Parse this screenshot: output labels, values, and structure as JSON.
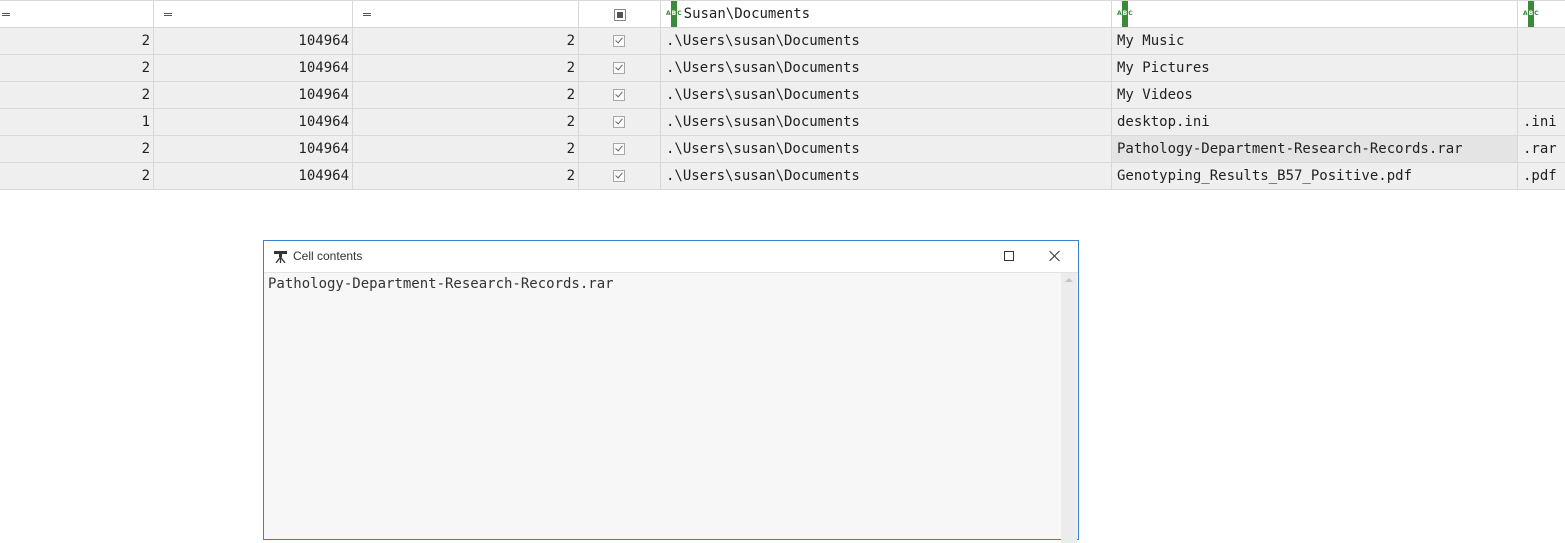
{
  "grid": {
    "header": {
      "path_column": "Susan\\Documents"
    },
    "rows": [
      {
        "c1": "2",
        "c2": "104964",
        "c3": "2",
        "checked": true,
        "path": ".\\Users\\susan\\Documents",
        "name": "My Music",
        "ext": ""
      },
      {
        "c1": "2",
        "c2": "104964",
        "c3": "2",
        "checked": true,
        "path": ".\\Users\\susan\\Documents",
        "name": "My Pictures",
        "ext": ""
      },
      {
        "c1": "2",
        "c2": "104964",
        "c3": "2",
        "checked": true,
        "path": ".\\Users\\susan\\Documents",
        "name": "My Videos",
        "ext": ""
      },
      {
        "c1": "1",
        "c2": "104964",
        "c3": "2",
        "checked": true,
        "path": ".\\Users\\susan\\Documents",
        "name": "desktop.ini",
        "ext": ".ini"
      },
      {
        "c1": "2",
        "c2": "104964",
        "c3": "2",
        "checked": true,
        "path": ".\\Users\\susan\\Documents",
        "name": "Pathology-Department-Research-Records.rar",
        "ext": ".rar"
      },
      {
        "c1": "2",
        "c2": "104964",
        "c3": "2",
        "checked": true,
        "path": ".\\Users\\susan\\Documents",
        "name": "Genotyping_Results_B57_Positive.pdf",
        "ext": ".pdf"
      }
    ]
  },
  "dialog": {
    "title": "Cell contents",
    "content": "Pathology-Department-Research-Records.rar"
  },
  "colors": {
    "row_bg": "#efefef",
    "dialog_border": "#3b7fd0",
    "text_type_icon": "#3a8a3a"
  }
}
